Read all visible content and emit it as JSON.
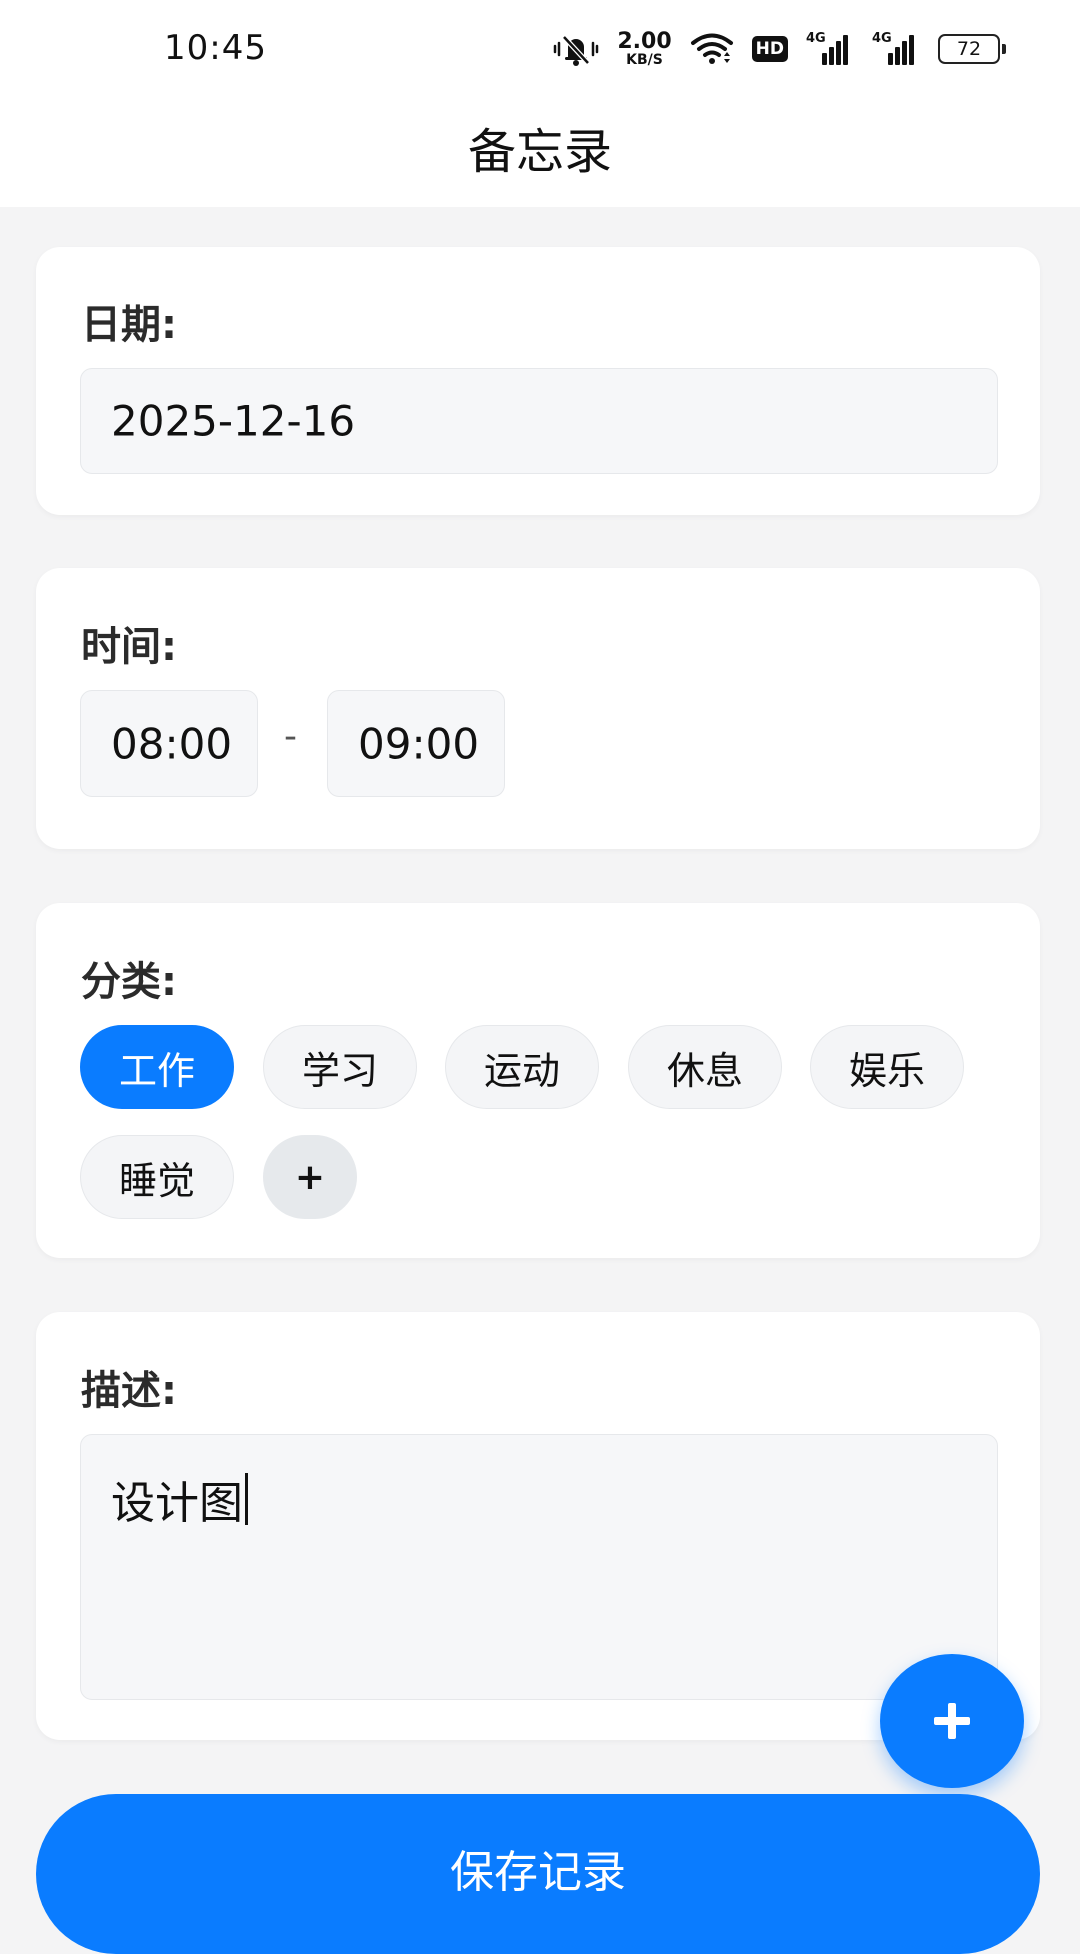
{
  "status_bar": {
    "time": "10:45",
    "net_speed_value": "2.00",
    "net_speed_unit": "KB/S",
    "hd_label": "HD",
    "signal1_label": "4G",
    "signal2_label": "4G",
    "battery_level": "72",
    "icons": [
      "mute-vibrate-icon",
      "wifi-icon",
      "hd-icon",
      "signal-icon",
      "signal-icon",
      "battery-icon"
    ]
  },
  "header": {
    "title": "备忘录"
  },
  "date_section": {
    "label": "日期:",
    "value": "2025-12-16"
  },
  "time_section": {
    "label": "时间:",
    "start": "08:00",
    "separator": "-",
    "end": "09:00"
  },
  "category_section": {
    "label": "分类:",
    "chips": [
      "工作",
      "学习",
      "运动",
      "休息",
      "娱乐",
      "睡觉"
    ],
    "selected": "工作",
    "add_label": "+"
  },
  "description_section": {
    "label": "描述:",
    "value": "设计图"
  },
  "fab": {
    "icon": "plus-icon"
  },
  "save_button": {
    "label": "保存记录"
  },
  "colors": {
    "accent": "#0a7cff",
    "background": "#f4f4f5",
    "card": "#ffffff",
    "field": "#f6f7f9"
  }
}
